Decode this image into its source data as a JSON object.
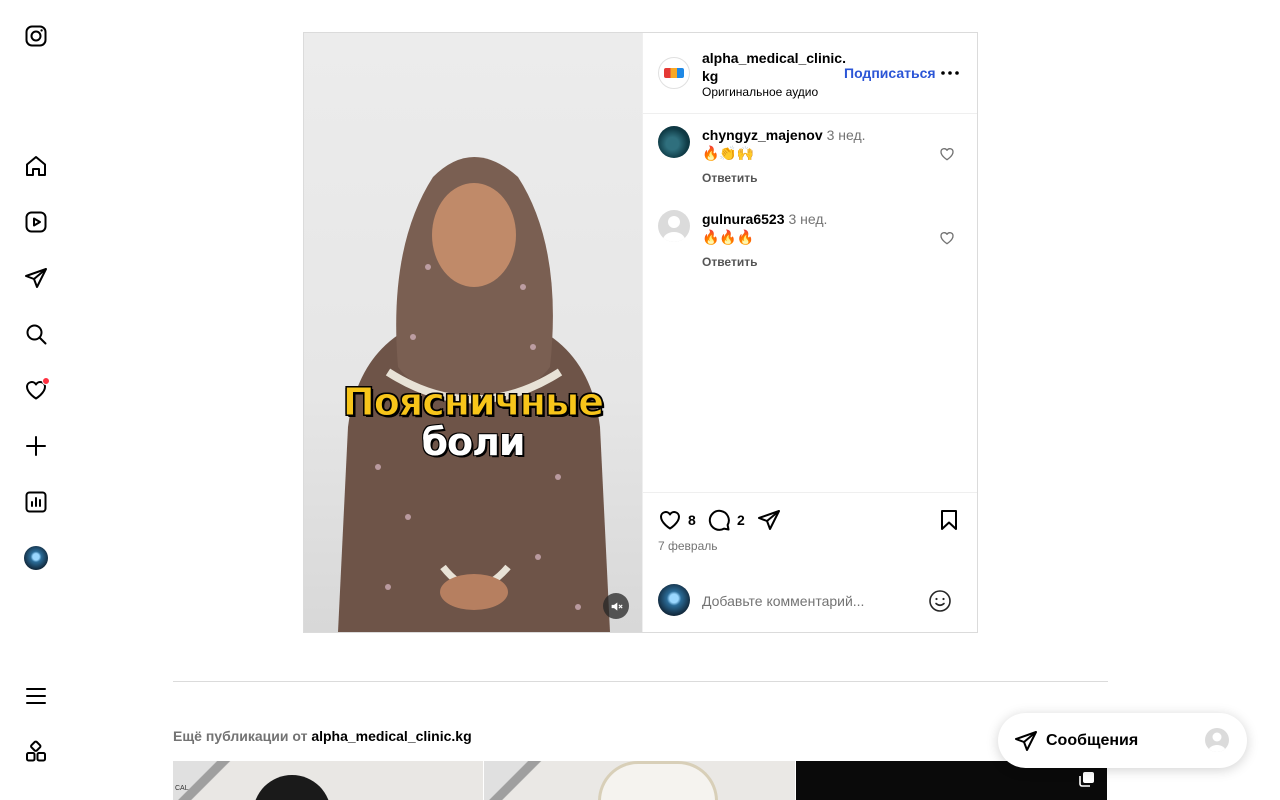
{
  "sidebar": {
    "items": [
      {
        "name": "instagram-logo",
        "label": "Instagram"
      },
      {
        "name": "home",
        "label": "Главная"
      },
      {
        "name": "reels",
        "label": "Reels"
      },
      {
        "name": "messages",
        "label": "Сообщения"
      },
      {
        "name": "search",
        "label": "Поисковый запрос"
      },
      {
        "name": "notifications",
        "label": "Уведомления"
      },
      {
        "name": "create",
        "label": "Создать"
      },
      {
        "name": "dashboard",
        "label": "Панель"
      },
      {
        "name": "profile",
        "label": "Профиль"
      },
      {
        "name": "more",
        "label": "Ещё"
      },
      {
        "name": "also-from-meta",
        "label": "Также от Meta"
      }
    ],
    "has_notification": true
  },
  "post": {
    "media": {
      "caption_line1": "Поясничные",
      "caption_line2": "боли",
      "muted": true
    },
    "header": {
      "username": "alpha_medical_clinic.kg",
      "audio": "Оригинальное аудио",
      "follow_label": "Подписаться"
    },
    "comments": [
      {
        "username": "chyngyz_majenov",
        "time": "3 нед.",
        "text": "🔥👏🙌",
        "reply_label": "Ответить"
      },
      {
        "username": "gulnura6523",
        "time": "3 нед.",
        "text": "🔥🔥🔥",
        "reply_label": "Ответить"
      }
    ],
    "actions": {
      "likes": "8",
      "comments": "2"
    },
    "date": "7 февраль",
    "add_comment": {
      "placeholder": "Добавьте комментарий..."
    }
  },
  "more_posts": {
    "prefix": "Ещё публикации от",
    "account": "alpha_medical_clinic.kg",
    "thumb_text": "CAL"
  },
  "messages_pill": {
    "label": "Сообщения"
  },
  "colors": {
    "accent": "#0095f6",
    "follow": "#2b55d6",
    "notification": "#ff3040",
    "caption_yellow": "#f7c51a"
  }
}
